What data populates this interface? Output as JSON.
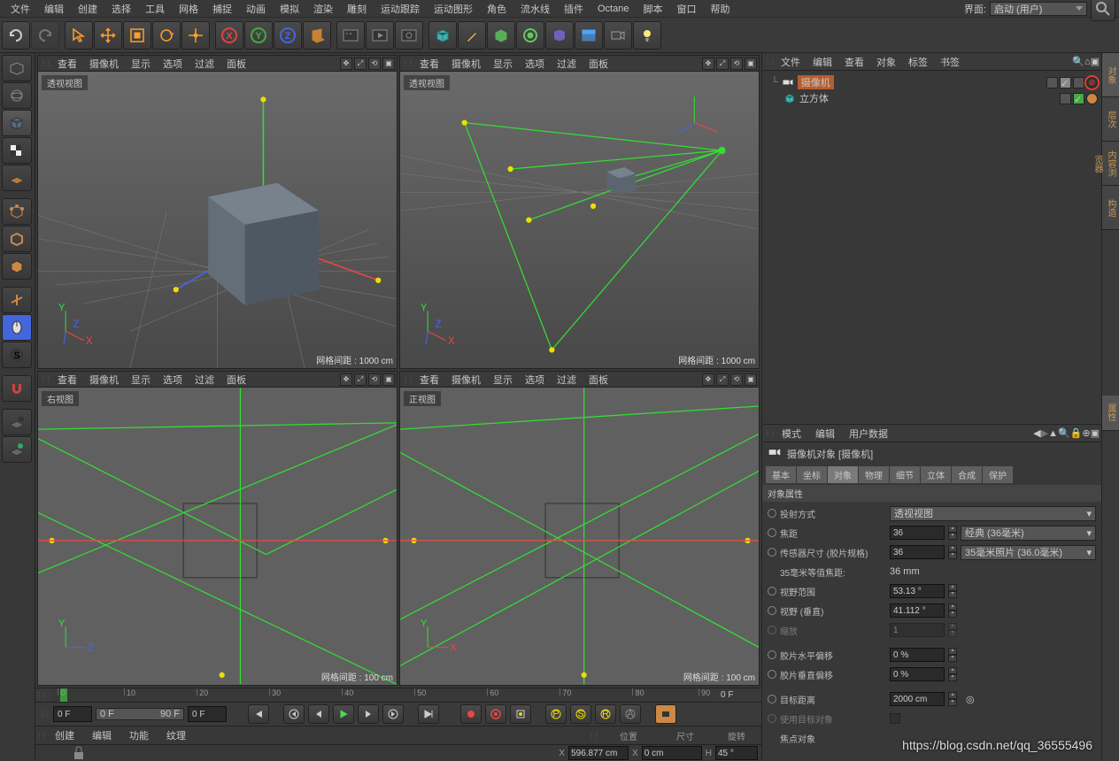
{
  "menubar": [
    "文件",
    "编辑",
    "创建",
    "选择",
    "工具",
    "网格",
    "捕捉",
    "动画",
    "模拟",
    "渲染",
    "雕刻",
    "运动跟踪",
    "运动图形",
    "角色",
    "流水线",
    "插件",
    "Octane",
    "脚本",
    "窗口",
    "帮助"
  ],
  "layout_label": "界面:",
  "layout_value": "启动 (用户)",
  "viewport_menu": [
    "查看",
    "摄像机",
    "显示",
    "选项",
    "过滤",
    "面板"
  ],
  "viewports": {
    "tl": {
      "label": "透视视图",
      "status": "网格间距 : 1000 cm"
    },
    "tr": {
      "label": "透视视图",
      "status": "网格间距 : 1000 cm"
    },
    "bl": {
      "label": "右视图",
      "status": "网格间距 : 100 cm"
    },
    "br": {
      "label": "正视图",
      "status": "网格间距 : 100 cm"
    }
  },
  "timeline": {
    "ticks": [
      0,
      10,
      20,
      30,
      40,
      50,
      60,
      70,
      80,
      90
    ],
    "start": "0 F",
    "end": "0 F"
  },
  "playbar": {
    "cur": "0 F",
    "range_a": "0 F",
    "range_b": "90 F",
    "after": "0 F"
  },
  "bottombar": [
    "创建",
    "编辑",
    "功能",
    "纹理"
  ],
  "coord": {
    "pos_lbl": "位置",
    "size_lbl": "尺寸",
    "rot_lbl": "旋转",
    "x": "596.877 cm",
    "sx": "0 cm",
    "h": "45 °",
    "xl": "X",
    "sxl": "X",
    "hl": "H"
  },
  "om_menu": [
    "文件",
    "编辑",
    "查看",
    "对象",
    "标签",
    "书签"
  ],
  "om_items": [
    {
      "name": "摄像机",
      "icon": "camera",
      "selected": true
    },
    {
      "name": "立方体",
      "icon": "cube",
      "selected": false
    }
  ],
  "am_menu": [
    "模式",
    "编辑",
    "用户数据"
  ],
  "am_title": "摄像机对象 [摄像机]",
  "am_tabs": [
    "基本",
    "坐标",
    "对象",
    "物理",
    "细节",
    "立体",
    "合成",
    "保护"
  ],
  "am_active_tab": "对象",
  "am_section": "对象属性",
  "am_rows": [
    {
      "t": "dd",
      "label": "投射方式",
      "value": "透视视图"
    },
    {
      "t": "numdd",
      "label": "焦距",
      "value": "36",
      "dd": "经典 (36毫米)"
    },
    {
      "t": "numdd",
      "label": "传感器尺寸 (胶片规格)",
      "value": "36",
      "dd": "35毫米照片 (36.0毫米)"
    },
    {
      "t": "static",
      "label": "35毫米等值焦距:",
      "value": "36 mm"
    },
    {
      "t": "num",
      "label": "视野范围",
      "value": "53.13 °"
    },
    {
      "t": "num",
      "label": "视野 (垂直)",
      "value": "41.112 °"
    },
    {
      "t": "num",
      "label": "缩放",
      "value": "1",
      "disabled": true
    },
    {
      "t": "sep"
    },
    {
      "t": "num",
      "label": "胶片水平偏移",
      "value": "0 %"
    },
    {
      "t": "num",
      "label": "胶片垂直偏移",
      "value": "0 %"
    },
    {
      "t": "sep"
    },
    {
      "t": "numtgt",
      "label": "目标距离",
      "value": "2000 cm"
    },
    {
      "t": "chk",
      "label": "使用目标对象",
      "disabled": true
    },
    {
      "t": "lbl",
      "label": "焦点对象"
    }
  ],
  "right_tabs": [
    "对象",
    "层次",
    "内容浏览器",
    "构造"
  ],
  "right_tabs2": [
    "属性"
  ],
  "watermark": "https://blog.csdn.net/qq_36555496"
}
